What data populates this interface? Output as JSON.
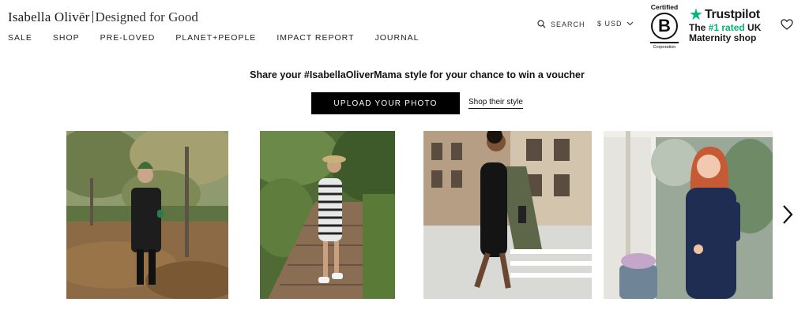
{
  "header": {
    "logo": {
      "brand": "Isabella Olivēr",
      "tagline": "Designed for Good"
    },
    "nav": [
      "SALE",
      "SHOP",
      "PRE-LOVED",
      "PLANET+PEOPLE",
      "IMPACT REPORT",
      "JOURNAL"
    ],
    "search_label": "SEARCH",
    "currency_label": "$ USD",
    "bcorp": {
      "top": "Certified",
      "letter": "B",
      "bottom": "Corporation"
    },
    "trustpilot": {
      "name": "Trustpilot",
      "line1_prefix": "The ",
      "line1_highlight": "#1 rated",
      "line1_suffix": " UK",
      "line2": "Maternity shop"
    },
    "icons": [
      "search-icon",
      "chevron-down-icon",
      "heart-icon",
      "star-icon"
    ]
  },
  "promo": {
    "text": "Share your #IsabellaOliverMama style for your chance to win a voucher",
    "upload_button": "UPLOAD YOUR PHOTO",
    "shop_link": "Shop their style"
  },
  "colors": {
    "accent_green": "#00b67a",
    "button_black": "#000000"
  },
  "gallery": {
    "photos": [
      "autumn-park-photo",
      "stone-steps-photo",
      "street-crossing-photo",
      "shop-window-photo"
    ],
    "next_icon": "chevron-right-icon"
  }
}
